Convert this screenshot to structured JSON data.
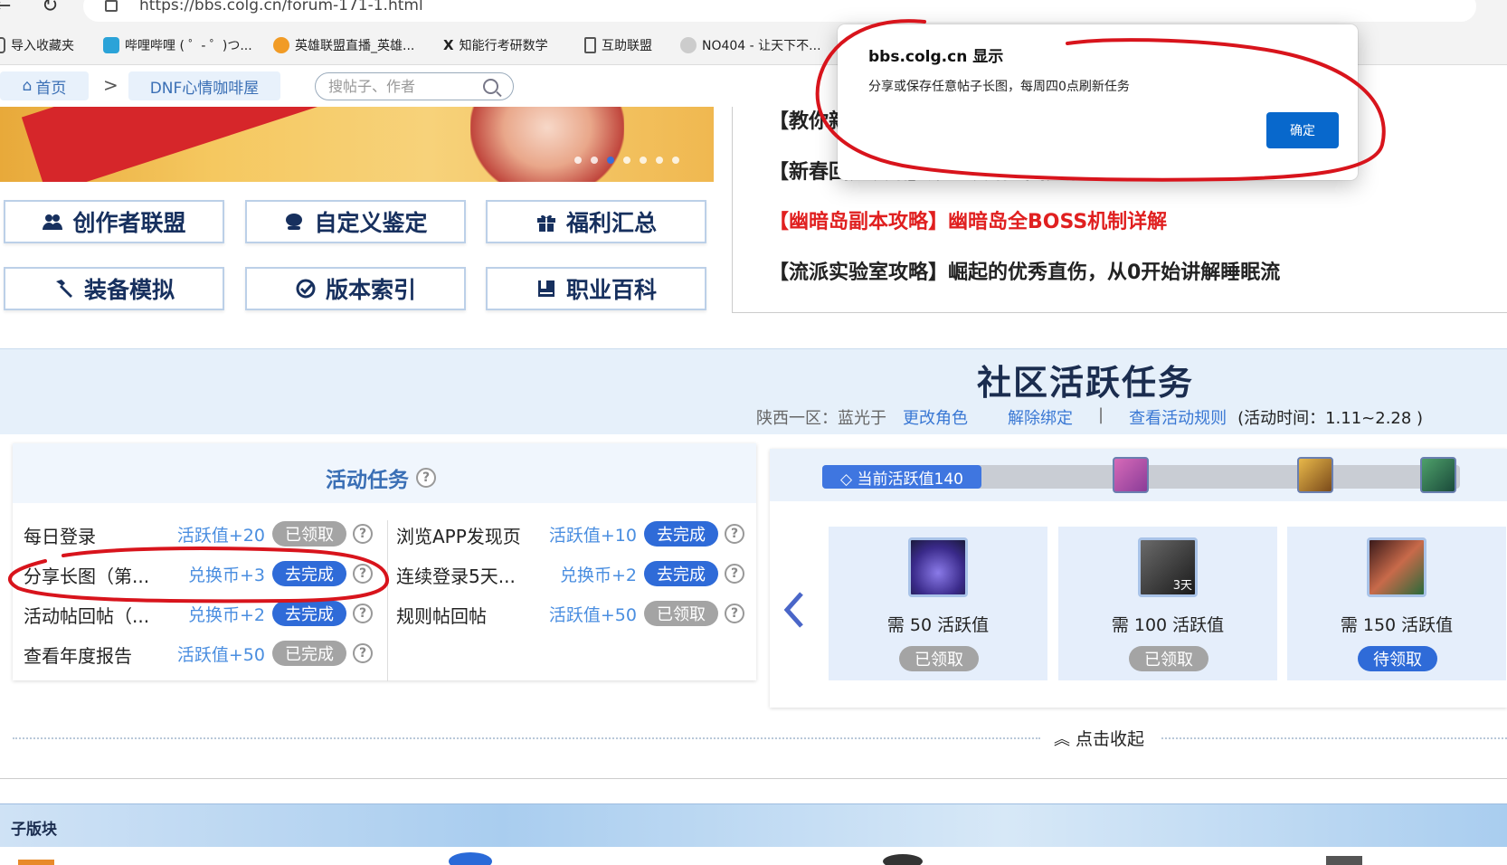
{
  "browser": {
    "url": "https://bbs.colg.cn/forum-171-1.html",
    "bookmarks": [
      "导入收藏夹",
      "哔哩哔哩 ( ゜- ゜)つ...",
      "英雄联盟直播_英雄...",
      "知能行考研数学",
      "互助联盟",
      "NO404 - 让天下不..."
    ]
  },
  "breadcrumb": {
    "home": "首页",
    "separator": ">",
    "board": "DNF心情咖啡屋"
  },
  "search": {
    "placeholder": "搜帖子、作者"
  },
  "quick_links": [
    "创作者联盟",
    "自定义鉴定",
    "福利汇总",
    "装备模拟",
    "版本索引",
    "职业百科"
  ],
  "news": [
    {
      "text": "【教你新",
      "color": "#222222"
    },
    {
      "text": "【新春回归攻略】账号攻略&回归活动三重助力",
      "color": "#222222"
    },
    {
      "text": "【幽暗岛副本攻略】幽暗岛全BOSS机制详解",
      "color": "#e02020"
    },
    {
      "text": "【流派实验室攻略】崛起的优秀直伤，从0开始讲解睡眠流",
      "color": "#222222"
    }
  ],
  "activity": {
    "title": "社区活跃任务",
    "server_char": "陕西一区：蓝光于",
    "change_role": "更改角色",
    "unbind": "解除绑定",
    "divider": "|",
    "rules": "查看活动规则",
    "time": "(活动时间：1.11~2.28 )"
  },
  "tasks": {
    "title": "活动任务",
    "left": [
      {
        "name": "每日登录",
        "reward": "活跃值+20",
        "status": "已领取",
        "state": "gray"
      },
      {
        "name": "分享长图（第...",
        "reward": "兑换币+3",
        "status": "去完成",
        "state": "blue"
      },
      {
        "name": "活动帖回帖（...",
        "reward": "兑换币+2",
        "status": "去完成",
        "state": "blue"
      },
      {
        "name": "查看年度报告",
        "reward": "活跃值+50",
        "status": "已完成",
        "state": "gray"
      }
    ],
    "right": [
      {
        "name": "浏览APP发现页",
        "reward": "活跃值+10",
        "status": "去完成",
        "state": "blue"
      },
      {
        "name": "连续登录5天...",
        "reward": "兑换币+2",
        "status": "去完成",
        "state": "blue"
      },
      {
        "name": "规则帖回帖",
        "reward": "活跃值+50",
        "status": "已领取",
        "state": "gray"
      }
    ],
    "help": "?"
  },
  "rewards": {
    "current_label": "◇ 当前活跃值140",
    "current_value": 140,
    "progress_fraction": 0.25,
    "cards": [
      {
        "need": "需 50 活跃值",
        "status": "已领取",
        "state": "gray",
        "badge": ""
      },
      {
        "need": "需 100 活跃值",
        "status": "已领取",
        "state": "gray",
        "badge": "3天"
      },
      {
        "need": "需 150 活跃值",
        "status": "待领取",
        "state": "blue",
        "badge": ""
      }
    ]
  },
  "collapse_label": "点击收起",
  "sub_board_title": "子版块",
  "dialog": {
    "title": "bbs.colg.cn 显示",
    "message": "分享或保存任意帖子长图，每周四0点刷新任务",
    "ok": "确定"
  },
  "colors": {
    "accent_blue": "#2f6bd8",
    "link_blue": "#3a78d4",
    "red": "#e02020",
    "annotation_red": "#d8141c"
  }
}
